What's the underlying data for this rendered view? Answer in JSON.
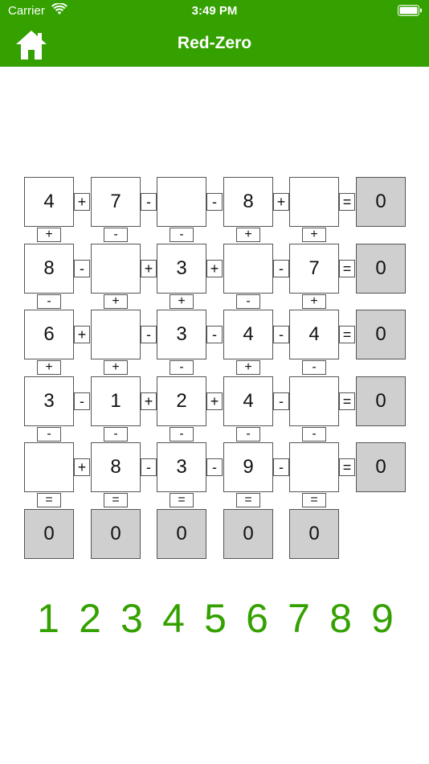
{
  "status_bar": {
    "carrier": "Carrier",
    "time": "3:49 PM"
  },
  "nav": {
    "title": "Red-Zero",
    "home_icon": "home-icon"
  },
  "colors": {
    "accent": "#34a100",
    "result_cell": "#cfcfcf"
  },
  "grid": {
    "rows": [
      {
        "cells": [
          "4",
          "7",
          "",
          "8",
          ""
        ],
        "ops": [
          "+",
          "-",
          "-",
          "+"
        ],
        "equals": "=",
        "result": "0"
      },
      {
        "cells": [
          "8",
          "",
          "3",
          "",
          "7"
        ],
        "ops": [
          "-",
          "+",
          "+",
          "-"
        ],
        "equals": "=",
        "result": "0"
      },
      {
        "cells": [
          "6",
          "",
          "3",
          "4",
          "4"
        ],
        "ops": [
          "+",
          "-",
          "-",
          "-"
        ],
        "equals": "=",
        "result": "0"
      },
      {
        "cells": [
          "3",
          "1",
          "2",
          "4",
          ""
        ],
        "ops": [
          "-",
          "+",
          "+",
          "-"
        ],
        "equals": "=",
        "result": "0"
      },
      {
        "cells": [
          "",
          "8",
          "3",
          "9",
          ""
        ],
        "ops": [
          "+",
          "-",
          "-",
          "-"
        ],
        "equals": "=",
        "result": "0"
      }
    ],
    "vertical_ops": [
      [
        "+",
        "-",
        "-",
        "+",
        "+"
      ],
      [
        "-",
        "+",
        "+",
        "-",
        "+"
      ],
      [
        "+",
        "+",
        "-",
        "+",
        "-"
      ],
      [
        "-",
        "-",
        "-",
        "-",
        "-"
      ],
      [
        "=",
        "=",
        "=",
        "=",
        "="
      ]
    ],
    "column_results": [
      "0",
      "0",
      "0",
      "0",
      "0"
    ]
  },
  "digits": [
    "1",
    "2",
    "3",
    "4",
    "5",
    "6",
    "7",
    "8",
    "9"
  ]
}
